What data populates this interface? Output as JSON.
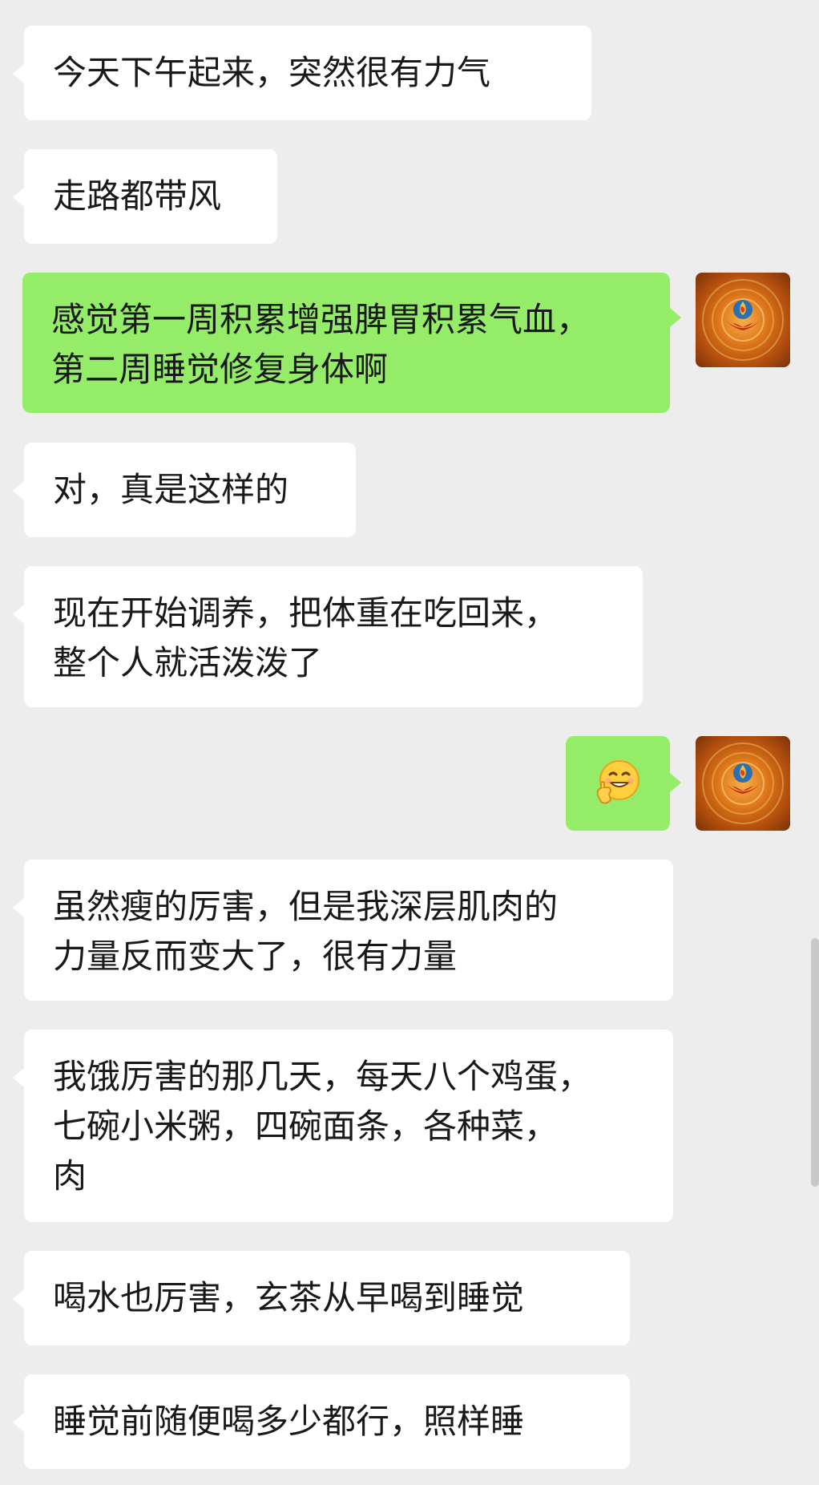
{
  "messages": [
    {
      "side": "left",
      "text": "今天下午起来，突然很有力气"
    },
    {
      "side": "left",
      "text": "走路都带风"
    },
    {
      "side": "right",
      "text": "感觉第一周积累增强脾胃积累气血，\n第二周睡觉修复身体啊"
    },
    {
      "side": "left",
      "text": "对，真是这样的"
    },
    {
      "side": "left",
      "text": "现在开始调养，把体重在吃回来，\n整个人就活泼泼了"
    },
    {
      "side": "right",
      "emoji": "grin-fist-emoji"
    },
    {
      "side": "left",
      "text": "虽然瘦的厉害，但是我深层肌肉的\n力量反而变大了，很有力量"
    },
    {
      "side": "left",
      "text": "我饿厉害的那几天，每天八个鸡蛋，\n七碗小米粥，四碗面条，各种菜，\n肉"
    },
    {
      "side": "left",
      "text": "喝水也厉害，玄茶从早喝到睡觉"
    },
    {
      "side": "left",
      "text": "睡觉前随便喝多少都行，照样睡"
    }
  ],
  "colors": {
    "background": "#ededed",
    "left_bubble": "#ffffff",
    "right_bubble": "#95ec69",
    "text": "#191919"
  },
  "avatar_icon": "lotus-flame-avatar-icon"
}
